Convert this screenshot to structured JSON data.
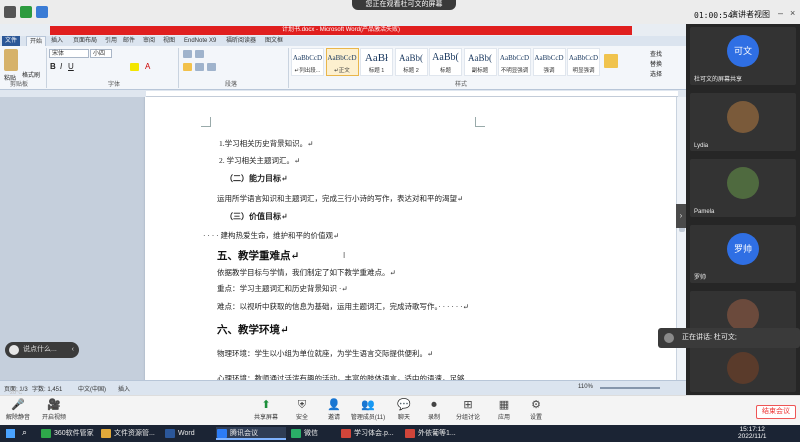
{
  "meeting_top": {
    "share_tip": "您正在观看杜可文的屏幕",
    "timer": "01:00:54",
    "presenter_view": "演讲者视图",
    "weather": "20°C"
  },
  "word": {
    "title": "计划书.docx - Microsoft Word(产品激活失败)",
    "tabs": [
      "文件",
      "开始",
      "插入",
      "页面布局",
      "引用",
      "邮件",
      "审阅",
      "视图",
      "EndNote X9",
      "福昕阅读器",
      "图文框"
    ],
    "active_tab": "开始",
    "font_name": "宋体",
    "font_size": "小四",
    "groups": [
      "剪贴板",
      "字体",
      "段落",
      "样式"
    ],
    "paste_label": "粘贴",
    "format_painter": "格式刷",
    "styles": [
      {
        "sample": "AaBbCcD",
        "name": "↵列出段..."
      },
      {
        "sample": "AaBbCcD",
        "name": "↵正文"
      },
      {
        "sample": "AaBł",
        "name": "标题 1"
      },
      {
        "sample": "AaBb(",
        "name": "标题 2"
      },
      {
        "sample": "AaBb(",
        "name": "标题"
      },
      {
        "sample": "AaBb(",
        "name": "副标题"
      },
      {
        "sample": "AaBbCcD",
        "name": "不明显强调"
      },
      {
        "sample": "AaBbCcD",
        "name": "强调"
      },
      {
        "sample": "AaBbCcD",
        "name": "明显强调"
      }
    ],
    "right_tools": [
      "查找",
      "替换",
      "选择"
    ],
    "document_lines": [
      {
        "kind": "p",
        "text": "1.学习相关历史背景知识。↵"
      },
      {
        "kind": "p",
        "text": "2. 学习相关主题词汇。↵"
      },
      {
        "kind": "h2",
        "text": "（二）能力目标↵"
      },
      {
        "kind": "p",
        "text": "运用所学语言知识和主题词汇，完成三行小诗的写作，表达对和平的渴望↵"
      },
      {
        "kind": "h2",
        "text": "（三）价值目标↵"
      },
      {
        "kind": "p",
        "text": "· · · · 建构热爱生命，维护和平的价值观↵"
      },
      {
        "kind": "h1",
        "text": "五、教学重难点↵"
      },
      {
        "kind": "p",
        "text": "依据教学目标与学情，我们制定了如下教学重难点。↵"
      },
      {
        "kind": "p",
        "text": "重点：学习主题词汇和历史背景知识 ·↵"
      },
      {
        "kind": "p",
        "text": "难点：以视听中获取的信息为基础，运用主题词汇，完成诗歌写作。· · · · · ·↵"
      },
      {
        "kind": "h1",
        "text": "六、教学环境↵"
      },
      {
        "kind": "p",
        "text": "物理环境：学生以小组为单位就座，为学生语言交际提供便利。↵"
      },
      {
        "kind": "p",
        "text": "心理环境：教师通过活泼有趣的活动，丰富的肢体语言，适中的语速，足够"
      }
    ],
    "status": {
      "page": "页面: 1/3",
      "words": "字数: 1,451",
      "lang": "中文(中国)",
      "insert": "插入",
      "zoom": "110%"
    }
  },
  "speech_pill": "说点什么...",
  "participants": [
    {
      "name": "杜可文的屏幕共享",
      "avatar_text": "可文",
      "color": "#2f6fe4"
    },
    {
      "name": "Lydia",
      "avatar_text": "",
      "color": "#7a5a3a"
    },
    {
      "name": "Pamela",
      "avatar_text": "",
      "color": "#4f6a3f"
    },
    {
      "name": "罗帅",
      "avatar_text": "罗帅",
      "color": "#2f6fe4"
    },
    {
      "name": "",
      "avatar_text": "",
      "color": "#6b4a3c"
    },
    {
      "name": "",
      "avatar_text": "",
      "color": "#5a3b2b"
    }
  ],
  "speaking_now": "正在讲话: 杜可文;",
  "meeting_toolbar": {
    "buttons": [
      "解除静音",
      "开启视频",
      "共享屏幕",
      "安全",
      "邀请",
      "管理成员(11)",
      "聊天",
      "录制",
      "分组讨论",
      "应用",
      "设置"
    ],
    "leave": "结束会议"
  },
  "taskbar": {
    "apps": [
      "360软件管家",
      "文件资源管...",
      "Word",
      "腾讯会议",
      "微信",
      "学习体会.p...",
      "外依葡等1..."
    ],
    "time": "15:17:12",
    "date": "2022/11/1"
  }
}
